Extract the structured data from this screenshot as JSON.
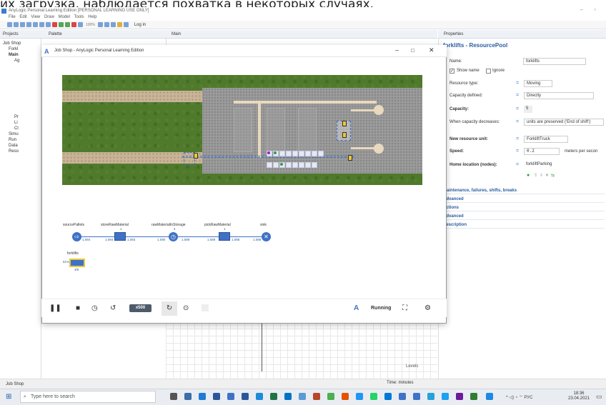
{
  "caption": "их загрузка, наблюдается похватка в некоторых случаях.",
  "ide": {
    "title": "AnyLogic Personal Learning Edition [PERSONAL LEARNING USE ONLY]",
    "menu": [
      "File",
      "Edit",
      "View",
      "Draw",
      "Model",
      "Tools",
      "Help"
    ],
    "zoom": "100%",
    "login": "Log in"
  },
  "left_panel": {
    "tabs": [
      "Projects",
      "Palette"
    ],
    "tree": [
      "Job Shop",
      "Forkl",
      "Main",
      "Ag",
      "Pr",
      "Li",
      "Cl",
      "Simu",
      "Run",
      "Data",
      "Reso"
    ]
  },
  "center": {
    "tab": "Main",
    "levels": "Levels"
  },
  "model_window": {
    "title": "Job Shop - AnyLogic Personal Learning Edition",
    "speed": "x500",
    "status": "Running",
    "flowchart": {
      "nodes": [
        {
          "label": "sourcePallets",
          "count": "1.094"
        },
        {
          "label": "storeRawMaterial",
          "top": "1",
          "count": "1.093"
        },
        {
          "label": "rawMaterialInStorage",
          "top": "4",
          "count": "1.089"
        },
        {
          "label": "pickRawMaterial",
          "top": "1",
          "count": "1.088"
        },
        {
          "label": "sink",
          "count": "1.088"
        }
      ],
      "in_counts": [
        "1.094",
        "1.090",
        "1.089"
      ],
      "pool": {
        "label": "forklifts",
        "util": "51%",
        "amount": "3/5"
      }
    }
  },
  "properties": {
    "tab": "Properties",
    "title": "forklifts - ResourcePool",
    "name_label": "Name:",
    "name_value": "forklifts",
    "show_name": "Show name",
    "ignore": "Ignore",
    "resource_type_label": "Resource type:",
    "resource_type_value": "Moving",
    "capacity_defined_label": "Capacity defined:",
    "capacity_defined_value": "Directly",
    "capacity_label": "Capacity:",
    "capacity_value": "5",
    "when_decreases_label": "When capacity decreases:",
    "when_decreases_value": "units are preserved ('End of shift')",
    "new_unit_label": "New resource unit:",
    "new_unit_value": "ForkliftTruck",
    "speed_label": "Speed:",
    "speed_value": "0.2",
    "speed_units": "meters per secon",
    "home_label": "Home location (nodes):",
    "home_value": "forkliftParking",
    "sections": [
      "Maintenance, failures, shifts, breaks",
      "Advanced",
      "Actions",
      "Advanced",
      "Description"
    ]
  },
  "status_bar": {
    "left": "Job Shop",
    "time": "Time: minutes"
  },
  "taskbar": {
    "search": "Type here to search",
    "lang": "РУС",
    "time": "18:36",
    "date": "23.04.2021"
  },
  "colors": {
    "accent": "#2a5d9f",
    "block": "#3f72c6",
    "grass": "#4f7a2c"
  }
}
